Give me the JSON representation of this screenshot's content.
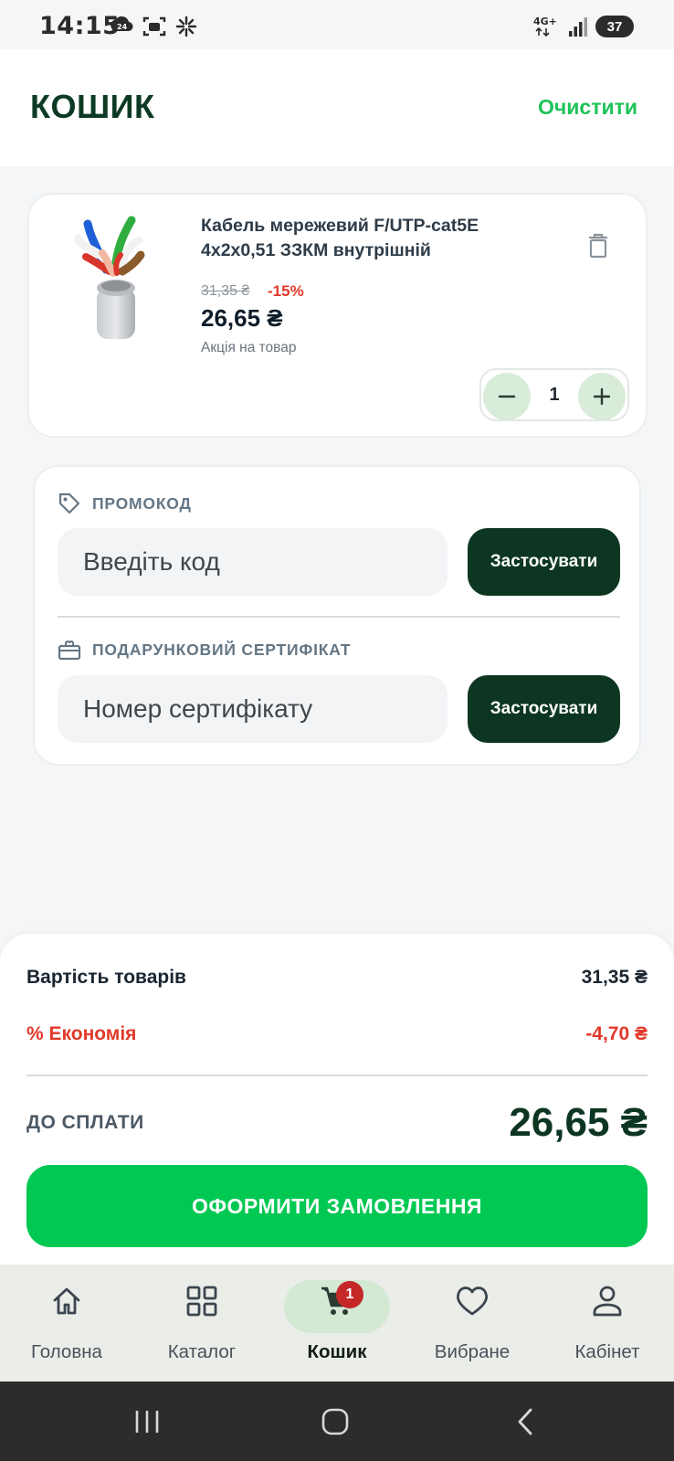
{
  "status_bar": {
    "time": "14:15",
    "notification_badge": "24",
    "network": "4G+",
    "battery": "37"
  },
  "header": {
    "title": "КОШИК",
    "clear_label": "Очистити"
  },
  "cart_item": {
    "title": "Кабель мережевий F/UTP-cat5E 4x2x0,51 ЗЗКМ внутрішній",
    "old_price": "31,35 ₴",
    "discount": "-15%",
    "price": "26,65 ₴",
    "promo_note": "Акція на товар",
    "quantity": "1"
  },
  "promo": {
    "label": "ПРОМОКОД",
    "placeholder": "Введіть код",
    "apply_label": "Застосувати"
  },
  "gift_certificate": {
    "label": "ПОДАРУНКОВИЙ СЕРТИФІКАТ",
    "placeholder": "Номер сертифікату",
    "apply_label": "Застосувати"
  },
  "summary": {
    "items_label": "Вартість товарів",
    "items_value": "31,35 ₴",
    "savings_label": "% Економія",
    "savings_value": "-4,70 ₴",
    "total_label": "ДО СПЛАТИ",
    "total_value": "26,65 ₴",
    "checkout_label": "ОФОРМИТИ ЗАМОВЛЕННЯ"
  },
  "bottom_nav": {
    "items": [
      {
        "label": "Головна",
        "icon": "home-icon"
      },
      {
        "label": "Каталог",
        "icon": "grid-icon"
      },
      {
        "label": "Кошик",
        "icon": "cart-icon",
        "active": true,
        "badge": "1"
      },
      {
        "label": "Вибране",
        "icon": "heart-icon"
      },
      {
        "label": "Кабінет",
        "icon": "user-icon"
      }
    ]
  },
  "colors": {
    "brand_dark": "#0c3622",
    "accent_green": "#00c853",
    "discount_red": "#e2392a"
  }
}
